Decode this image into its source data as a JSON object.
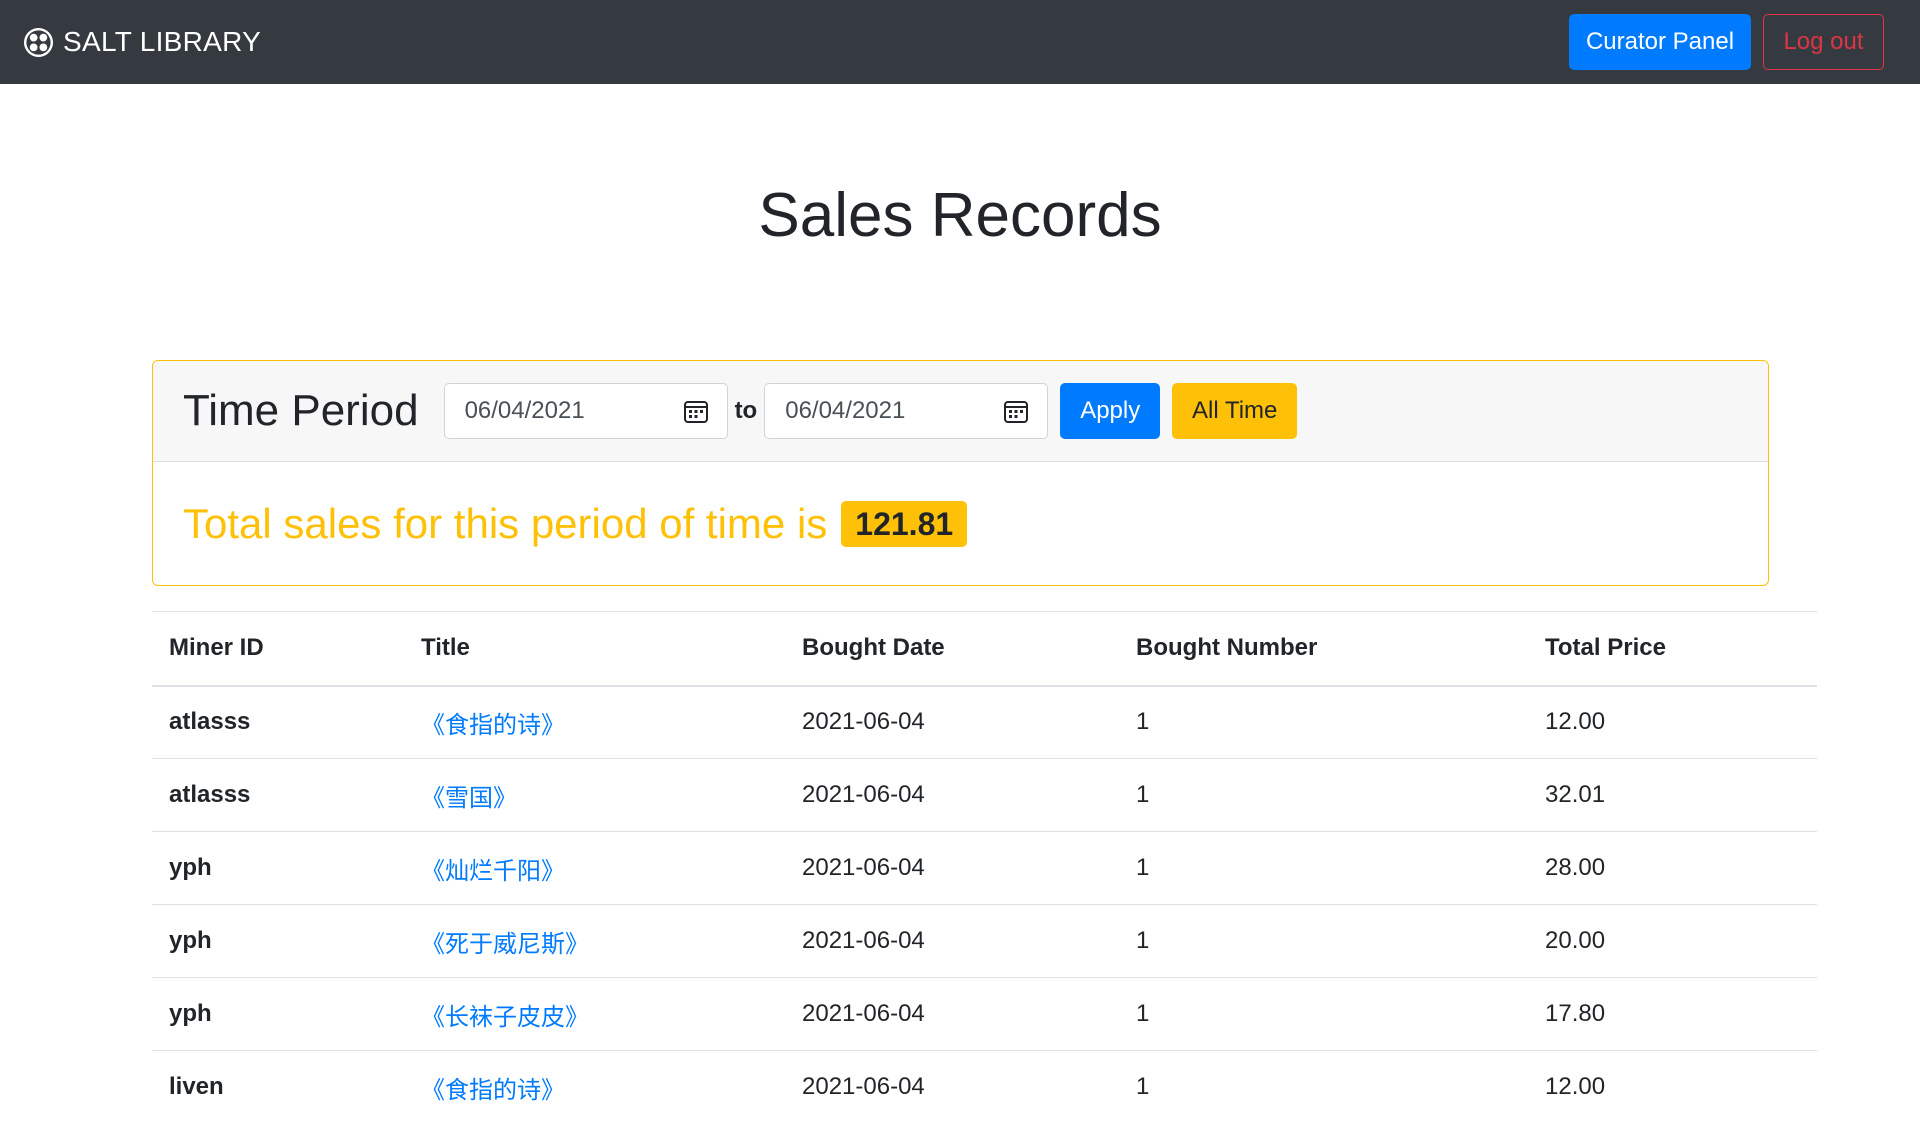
{
  "navbar": {
    "brand": "SALT LIBRARY",
    "curator_panel": "Curator Panel",
    "log_out": "Log out"
  },
  "page": {
    "title": "Sales Records"
  },
  "period": {
    "heading": "Time Period",
    "from_value": "06/04/2021",
    "to_label": "to",
    "to_value": "06/04/2021",
    "apply": "Apply",
    "all_time": "All Time",
    "total_text": "Total sales for this period of time is",
    "total_value": "121.81"
  },
  "table": {
    "headers": [
      "Miner ID",
      "Title",
      "Bought Date",
      "Bought Number",
      "Total Price"
    ],
    "rows": [
      {
        "miner": "atlasss",
        "title": "《食指的诗》",
        "date": "2021-06-04",
        "number": "1",
        "price": "12.00"
      },
      {
        "miner": "atlasss",
        "title": "《雪国》",
        "date": "2021-06-04",
        "number": "1",
        "price": "32.01"
      },
      {
        "miner": "yph",
        "title": "《灿烂千阳》",
        "date": "2021-06-04",
        "number": "1",
        "price": "28.00"
      },
      {
        "miner": "yph",
        "title": "《死于威尼斯》",
        "date": "2021-06-04",
        "number": "1",
        "price": "20.00"
      },
      {
        "miner": "yph",
        "title": "《长袜子皮皮》",
        "date": "2021-06-04",
        "number": "1",
        "price": "17.80"
      },
      {
        "miner": "liven",
        "title": "《食指的诗》",
        "date": "2021-06-04",
        "number": "1",
        "price": "12.00"
      }
    ]
  },
  "icons": {
    "brand": "salt-logo-icon",
    "date_picker": "calendar-icon"
  },
  "colors": {
    "navbar_bg": "#343a40",
    "primary": "#007bff",
    "danger": "#dc3545",
    "warning": "#ffc107"
  }
}
